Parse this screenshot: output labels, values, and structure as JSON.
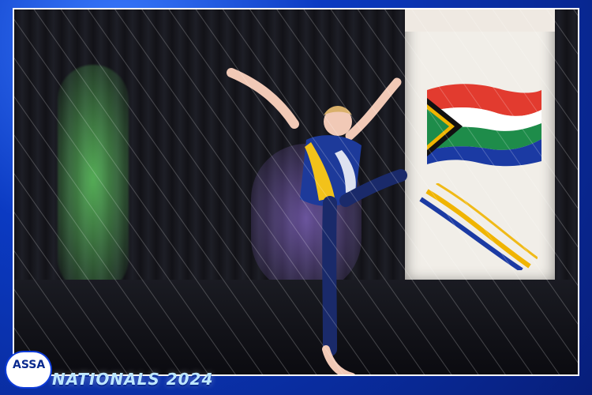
{
  "event": {
    "logo_text": "ASSA",
    "footer_text": "NATIONALS 2024"
  },
  "colors": {
    "frame": "#0b3ac2",
    "stage_dark": "#121217",
    "uniform_blue": "#1d3a9a",
    "uniform_yellow": "#f2c21a",
    "flag_red": "#e23b2f",
    "flag_green": "#1e8c4a",
    "flag_blue": "#1b3aa3",
    "flag_yellow": "#f0b400"
  },
  "icons": {
    "badge": "assa-badge-icon",
    "flag": "south-africa-flag-icon",
    "dancer": "dancer-figure-icon"
  }
}
